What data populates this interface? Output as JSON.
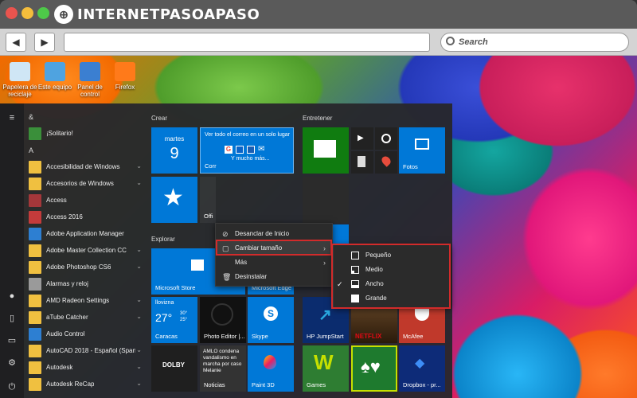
{
  "browser": {
    "logo_text": "INTERNETPASOAPASO",
    "search_placeholder": "Search",
    "back_icon": "back-arrow-icon",
    "forward_icon": "forward-arrow-icon"
  },
  "desktop_icons": [
    {
      "label": "Papelera de reciclaje",
      "icon": "recycle-bin-icon",
      "color": "#cfe6f5"
    },
    {
      "label": "Este equipo",
      "icon": "computer-icon",
      "color": "#4fa3e0"
    },
    {
      "label": "Panel de control",
      "icon": "control-panel-icon",
      "color": "#3b7fd1"
    },
    {
      "label": "Firefox",
      "icon": "firefox-icon",
      "color": "#ff7a1a"
    }
  ],
  "start_menu": {
    "app_list": [
      {
        "kind": "letter",
        "label": "&"
      },
      {
        "kind": "app",
        "label": "¡Solitario!",
        "color": "#3a8f3a",
        "chevron": false
      },
      {
        "kind": "letter",
        "label": "A"
      },
      {
        "kind": "app",
        "label": "Accesibilidad de Windows",
        "color": "#f0c040",
        "chevron": true
      },
      {
        "kind": "app",
        "label": "Accesorios de Windows",
        "color": "#f0c040",
        "chevron": true
      },
      {
        "kind": "app",
        "label": "Access",
        "color": "#a4373a",
        "chevron": false
      },
      {
        "kind": "app",
        "label": "Access 2016",
        "color": "#c43b3b",
        "chevron": false
      },
      {
        "kind": "app",
        "label": "Adobe Application Manager",
        "color": "#2d7fd2",
        "chevron": false
      },
      {
        "kind": "app",
        "label": "Adobe Master Collection CC",
        "color": "#f0c040",
        "chevron": true
      },
      {
        "kind": "app",
        "label": "Adobe Photoshop CS6",
        "color": "#f0c040",
        "chevron": true
      },
      {
        "kind": "app",
        "label": "Alarmas y reloj",
        "color": "#9a9a9a",
        "chevron": false
      },
      {
        "kind": "app",
        "label": "AMD Radeon Settings",
        "color": "#f0c040",
        "chevron": true
      },
      {
        "kind": "app",
        "label": "aTube Catcher",
        "color": "#f0c040",
        "chevron": true
      },
      {
        "kind": "app",
        "label": "Audio Control",
        "color": "#2d7fd2",
        "chevron": false
      },
      {
        "kind": "app",
        "label": "AutoCAD 2018 - Español (Spanis...",
        "color": "#f0c040",
        "chevron": true
      },
      {
        "kind": "app",
        "label": "Autodesk",
        "color": "#f0c040",
        "chevron": true
      },
      {
        "kind": "app",
        "label": "Autodesk ReCap",
        "color": "#f0c040",
        "chevron": true
      }
    ],
    "rail_icons": [
      "hamburger-menu-icon",
      "user-icon",
      "document-icon",
      "pictures-icon",
      "settings-icon",
      "power-icon"
    ],
    "groups": {
      "crear": "Crear",
      "explorar": "Explorar",
      "entretener": "Entretener"
    },
    "tiles": {
      "calendar_day": "martes",
      "calendar_date": "9",
      "mail_heading": "Ver todo el correo en un solo lugar",
      "mail_more": "Y mucho más...",
      "mail_label": "Corr",
      "office_label": "Offi",
      "store": "Microsoft Store",
      "edge": "Microsoft Edge",
      "weather_status": "llovizna",
      "weather_temp": "27°",
      "weather_temp_small": "30°",
      "weather_low": "25°",
      "weather_city": "Caracas",
      "photo_editor": "Photo Editor |...",
      "skype": "Skype",
      "news_headline": "AMLO condena vandalismo en marcha por caso Melanie",
      "news_label": "Noticias",
      "paint3d": "Paint 3D",
      "dolby": "DOLBY",
      "fotos": "Fotos",
      "hp": "HP JumpStart",
      "netflix": "NETFLIX",
      "mcafee": "McAfee",
      "games": "Games",
      "dropbox": "Dropbox - pr..."
    }
  },
  "context_menu": {
    "items": [
      {
        "label": "Desanclar de Inicio",
        "icon": "unpin-icon",
        "submenu": false
      },
      {
        "label": "Cambiar tamaño",
        "icon": "resize-icon",
        "submenu": true
      },
      {
        "label": "Más",
        "icon": "",
        "submenu": true
      },
      {
        "label": "Desinstalar",
        "icon": "trash-icon",
        "submenu": false
      }
    ]
  },
  "size_submenu": {
    "items": [
      {
        "label": "Pequeño",
        "checked": false
      },
      {
        "label": "Medio",
        "checked": false
      },
      {
        "label": "Ancho",
        "checked": true
      },
      {
        "label": "Grande",
        "checked": false
      }
    ],
    "check_mark": "✓"
  },
  "colors": {
    "highlight": "#d22b2b",
    "tile_blue": "#0078d7",
    "tile_green": "#107c10"
  }
}
